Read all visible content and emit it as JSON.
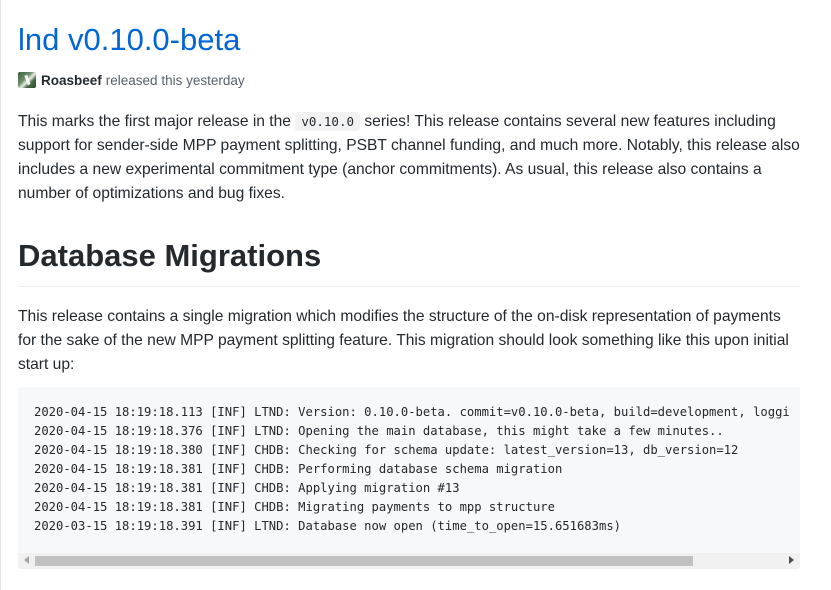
{
  "release": {
    "title": "lnd v0.10.0-beta",
    "author": "Roasbeef",
    "released_text": "released this yesterday"
  },
  "intro": {
    "part1": "This marks the first major release in the ",
    "code": "v0.10.0",
    "part2": " series! This release contains several new features including support for sender-side MPP payment splitting, PSBT channel funding, and much more. Notably, this release also includes a new experimental commitment type (anchor commitments). As usual, this release also contains a number of optimizations and bug fixes."
  },
  "section": {
    "heading": "Database Migrations",
    "text": "This release contains a single migration which modifies the structure of the on-disk representation of payments for the sake of the new MPP payment splitting feature. This migration should look something like this upon initial start up:"
  },
  "code_block": {
    "lines": [
      "2020-04-15 18:19:18.113 [INF] LTND: Version: 0.10.0-beta. commit=v0.10.0-beta, build=development, loggi",
      "2020-04-15 18:19:18.376 [INF] LTND: Opening the main database, this might take a few minutes..",
      "2020-04-15 18:19:18.380 [INF] CHDB: Checking for schema update: latest_version=13, db_version=12",
      "2020-04-15 18:19:18.381 [INF] CHDB: Performing database schema migration",
      "2020-04-15 18:19:18.381 [INF] CHDB: Applying migration #13",
      "2020-04-15 18:19:18.381 [INF] CHDB: Migrating payments to mpp structure",
      "2020-03-15 18:19:18.391 [INF] LTND: Database now open (time_to_open=15.651683ms)"
    ],
    "scroll_fraction": 0.0,
    "thumb_fraction": 0.88
  },
  "colors": {
    "link": "#0366d6",
    "text": "#24292e",
    "muted": "#586069",
    "code_bg": "#f6f8fa"
  }
}
